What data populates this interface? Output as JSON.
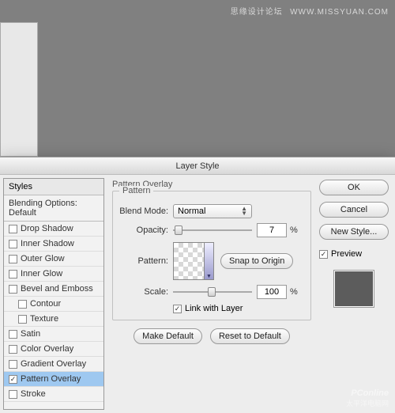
{
  "watermark_top": {
    "text": "思缘设计论坛",
    "url": "WWW.MISSYUAN.COM"
  },
  "watermark_bottom": {
    "brand": "PConline",
    "sub": "太平洋电脑网"
  },
  "dialog": {
    "title": "Layer Style",
    "styles_header": "Styles",
    "blending_options": "Blending Options: Default",
    "items": [
      {
        "label": "Drop Shadow",
        "checked": false
      },
      {
        "label": "Inner Shadow",
        "checked": false
      },
      {
        "label": "Outer Glow",
        "checked": false
      },
      {
        "label": "Inner Glow",
        "checked": false
      },
      {
        "label": "Bevel and Emboss",
        "checked": false
      },
      {
        "label": "Contour",
        "checked": false,
        "indent": true
      },
      {
        "label": "Texture",
        "checked": false,
        "indent": true
      },
      {
        "label": "Satin",
        "checked": false
      },
      {
        "label": "Color Overlay",
        "checked": false
      },
      {
        "label": "Gradient Overlay",
        "checked": false
      },
      {
        "label": "Pattern Overlay",
        "checked": true,
        "selected": true
      },
      {
        "label": "Stroke",
        "checked": false
      }
    ],
    "panel": {
      "group_title": "Pattern Overlay",
      "fieldset_legend": "Pattern",
      "blend_mode_label": "Blend Mode:",
      "blend_mode_value": "Normal",
      "opacity_label": "Opacity:",
      "opacity_value": "7",
      "pattern_label": "Pattern:",
      "snap_btn": "Snap to Origin",
      "scale_label": "Scale:",
      "scale_value": "100",
      "link_label": "Link with Layer",
      "link_checked": true,
      "make_default": "Make Default",
      "reset_default": "Reset to Default",
      "percent": "%"
    },
    "right": {
      "ok": "OK",
      "cancel": "Cancel",
      "new_style": "New Style...",
      "preview_label": "Preview",
      "preview_checked": true
    }
  }
}
